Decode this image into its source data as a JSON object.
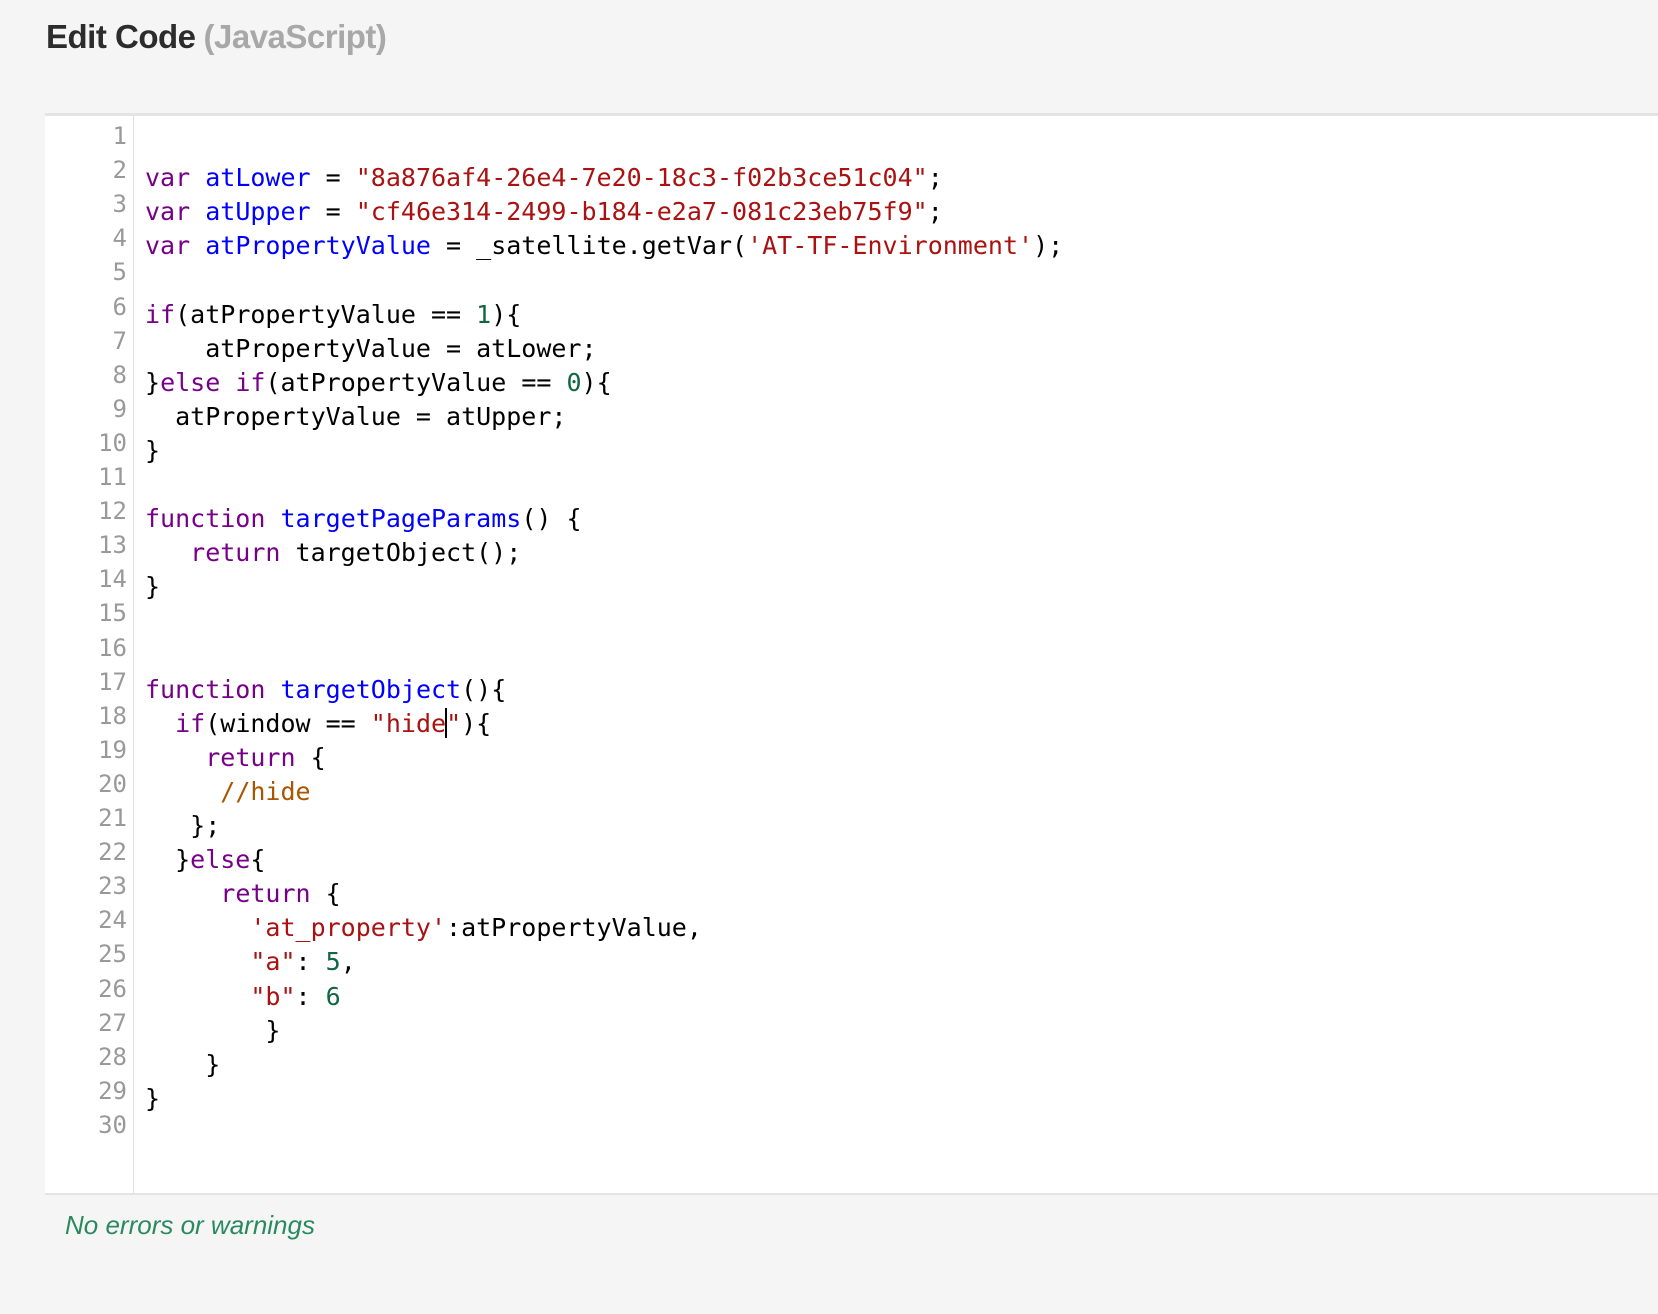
{
  "header": {
    "title": "Edit Code",
    "subtitle": "(JavaScript)"
  },
  "editor": {
    "language": "JavaScript",
    "cursor": {
      "line": 18,
      "after_text": "if(window == \"hide"
    },
    "colors": {
      "keyword": "#770088",
      "def": "#0000ff",
      "variable": "#000000",
      "string": "#aa1111",
      "number": "#116644",
      "comment": "#aa5500",
      "gutter_text": "#999999"
    },
    "lines": [
      {
        "n": "1",
        "tokens": []
      },
      {
        "n": "2",
        "tokens": [
          [
            "keyword",
            "var"
          ],
          [
            "plain",
            " "
          ],
          [
            "def",
            "atLower"
          ],
          [
            "plain",
            " = "
          ],
          [
            "string",
            "\"8a876af4-26e4-7e20-18c3-f02b3ce51c04\""
          ],
          [
            "plain",
            ";"
          ]
        ]
      },
      {
        "n": "3",
        "tokens": [
          [
            "keyword",
            "var"
          ],
          [
            "plain",
            " "
          ],
          [
            "def",
            "atUpper"
          ],
          [
            "plain",
            " = "
          ],
          [
            "string",
            "\"cf46e314-2499-b184-e2a7-081c23eb75f9\""
          ],
          [
            "plain",
            ";"
          ]
        ]
      },
      {
        "n": "4",
        "tokens": [
          [
            "keyword",
            "var"
          ],
          [
            "plain",
            " "
          ],
          [
            "def",
            "atPropertyValue"
          ],
          [
            "plain",
            " = _satellite.getVar("
          ],
          [
            "string",
            "'AT-TF-Environment'"
          ],
          [
            "plain",
            ");"
          ]
        ]
      },
      {
        "n": "5",
        "tokens": []
      },
      {
        "n": "6",
        "tokens": [
          [
            "keyword",
            "if"
          ],
          [
            "plain",
            "(atPropertyValue == "
          ],
          [
            "number",
            "1"
          ],
          [
            "plain",
            "){"
          ]
        ]
      },
      {
        "n": "7",
        "tokens": [
          [
            "plain",
            "    atPropertyValue = atLower;"
          ]
        ]
      },
      {
        "n": "8",
        "tokens": [
          [
            "plain",
            "}"
          ],
          [
            "keyword",
            "else"
          ],
          [
            "plain",
            " "
          ],
          [
            "keyword",
            "if"
          ],
          [
            "plain",
            "(atPropertyValue == "
          ],
          [
            "number",
            "0"
          ],
          [
            "plain",
            "){"
          ]
        ]
      },
      {
        "n": "9",
        "tokens": [
          [
            "plain",
            "  atPropertyValue = atUpper;"
          ]
        ]
      },
      {
        "n": "10",
        "tokens": [
          [
            "plain",
            "}"
          ]
        ]
      },
      {
        "n": "11",
        "tokens": []
      },
      {
        "n": "12",
        "tokens": [
          [
            "keyword",
            "function"
          ],
          [
            "plain",
            " "
          ],
          [
            "def",
            "targetPageParams"
          ],
          [
            "plain",
            "() {"
          ]
        ]
      },
      {
        "n": "13",
        "tokens": [
          [
            "plain",
            "   "
          ],
          [
            "keyword",
            "return"
          ],
          [
            "plain",
            " targetObject();"
          ]
        ]
      },
      {
        "n": "14",
        "tokens": [
          [
            "plain",
            "}"
          ]
        ]
      },
      {
        "n": "15",
        "tokens": []
      },
      {
        "n": "16",
        "tokens": []
      },
      {
        "n": "17",
        "tokens": [
          [
            "keyword",
            "function"
          ],
          [
            "plain",
            " "
          ],
          [
            "def",
            "targetObject"
          ],
          [
            "plain",
            "(){"
          ]
        ]
      },
      {
        "n": "18",
        "tokens": [
          [
            "plain",
            "  "
          ],
          [
            "keyword",
            "if"
          ],
          [
            "plain",
            "(window == "
          ],
          [
            "string",
            "\"hide"
          ],
          [
            "cursor",
            ""
          ],
          [
            "string",
            "\""
          ],
          [
            "plain",
            "){"
          ]
        ]
      },
      {
        "n": "19",
        "tokens": [
          [
            "plain",
            "    "
          ],
          [
            "keyword",
            "return"
          ],
          [
            "plain",
            " {"
          ]
        ]
      },
      {
        "n": "20",
        "tokens": [
          [
            "plain",
            "     "
          ],
          [
            "comment",
            "//hide"
          ]
        ]
      },
      {
        "n": "21",
        "tokens": [
          [
            "plain",
            "   };"
          ]
        ]
      },
      {
        "n": "22",
        "tokens": [
          [
            "plain",
            "  }"
          ],
          [
            "keyword",
            "else"
          ],
          [
            "plain",
            "{"
          ]
        ]
      },
      {
        "n": "23",
        "tokens": [
          [
            "plain",
            "     "
          ],
          [
            "keyword",
            "return"
          ],
          [
            "plain",
            " {"
          ]
        ]
      },
      {
        "n": "24",
        "tokens": [
          [
            "plain",
            "       "
          ],
          [
            "string",
            "'at_property'"
          ],
          [
            "plain",
            ":atPropertyValue,"
          ]
        ]
      },
      {
        "n": "25",
        "tokens": [
          [
            "plain",
            "       "
          ],
          [
            "string",
            "\"a\""
          ],
          [
            "plain",
            ": "
          ],
          [
            "number",
            "5"
          ],
          [
            "plain",
            ","
          ]
        ]
      },
      {
        "n": "26",
        "tokens": [
          [
            "plain",
            "       "
          ],
          [
            "string",
            "\"b\""
          ],
          [
            "plain",
            ": "
          ],
          [
            "number",
            "6"
          ]
        ]
      },
      {
        "n": "27",
        "tokens": [
          [
            "plain",
            "        }"
          ]
        ]
      },
      {
        "n": "28",
        "tokens": [
          [
            "plain",
            "    }"
          ]
        ]
      },
      {
        "n": "29",
        "tokens": [
          [
            "plain",
            "}"
          ]
        ]
      },
      {
        "n": "30",
        "tokens": []
      }
    ]
  },
  "status": {
    "message": "No errors or warnings",
    "color": "#2a8a5f"
  }
}
